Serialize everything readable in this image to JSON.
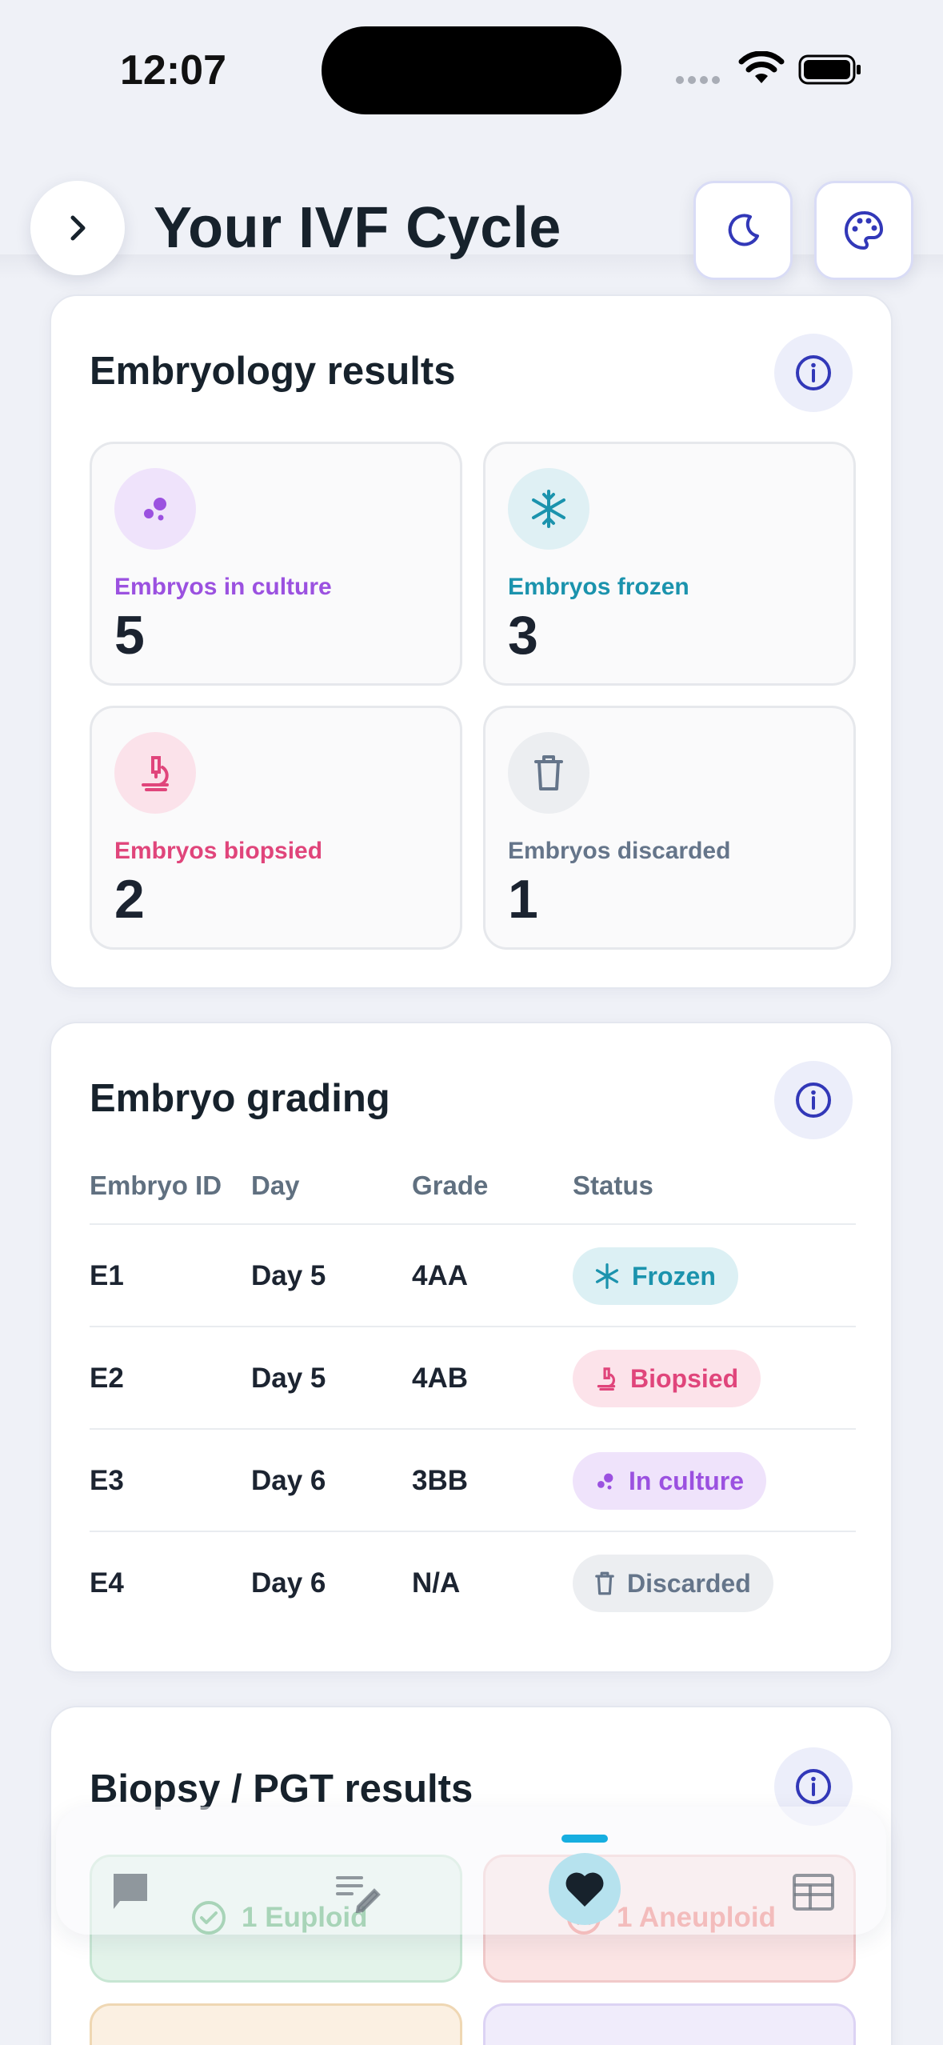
{
  "status_bar": {
    "time": "12:07"
  },
  "header": {
    "title": "Your IVF Cycle"
  },
  "embryology": {
    "title": "Embryology results",
    "stats": [
      {
        "label": "Embryos in culture",
        "value": "5",
        "icon": "culture-dots-icon",
        "color": "#9b51e0",
        "icon_bg": "#efe3fb"
      },
      {
        "label": "Embryos frozen",
        "value": "3",
        "icon": "snowflake-icon",
        "color": "#1b93ad",
        "icon_bg": "#dff0f4"
      },
      {
        "label": "Embryos biopsied",
        "value": "2",
        "icon": "microscope-icon",
        "color": "#e0457b",
        "icon_bg": "#fbe2ea"
      },
      {
        "label": "Embryos discarded",
        "value": "1",
        "icon": "trash-icon",
        "color": "#65758a",
        "icon_bg": "#eceef1"
      }
    ]
  },
  "grading": {
    "title": "Embryo grading",
    "columns": [
      "Embryo ID",
      "Day",
      "Grade",
      "Status"
    ],
    "rows": [
      {
        "id": "E1",
        "day": "Day 5",
        "grade": "4AA",
        "status": "Frozen"
      },
      {
        "id": "E2",
        "day": "Day 5",
        "grade": "4AB",
        "status": "Biopsied"
      },
      {
        "id": "E3",
        "day": "Day 6",
        "grade": "3BB",
        "status": "In culture"
      },
      {
        "id": "E4",
        "day": "Day 6",
        "grade": "N/A",
        "status": "Discarded"
      }
    ]
  },
  "pgt": {
    "title": "Biopsy / PGT results",
    "euploid": "1 Euploid",
    "aneuploid": "1 Aneuploid"
  },
  "nav": {
    "items": [
      "chat-icon",
      "notes-edit-icon",
      "heart-icon",
      "calendar-grid-icon"
    ],
    "active": "heart-icon",
    "accent": "#16aee0"
  }
}
